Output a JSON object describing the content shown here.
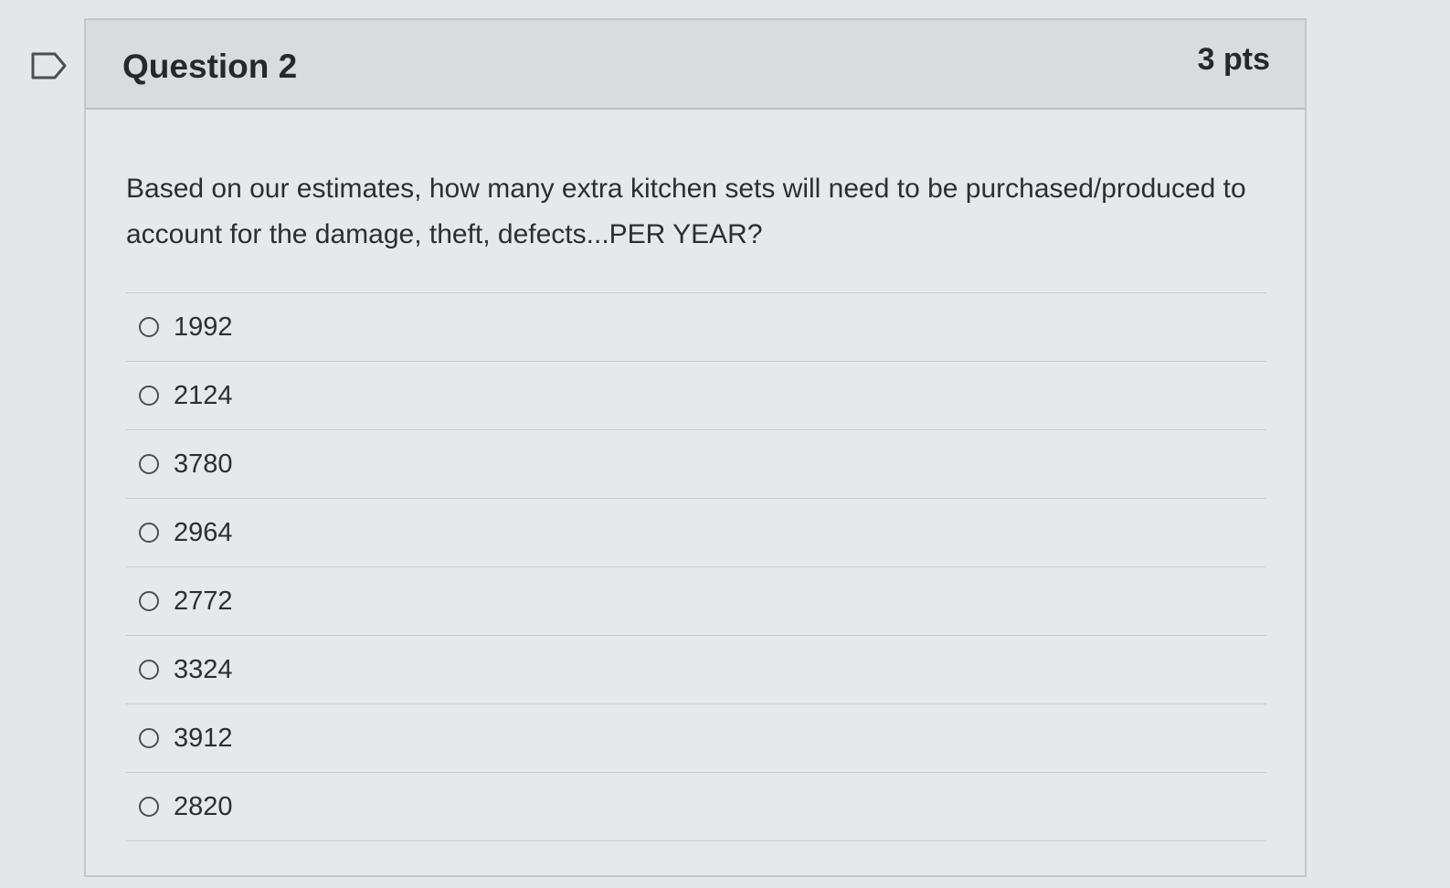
{
  "question": {
    "title": "Question 2",
    "points": "3 pts",
    "text": "Based on our estimates, how many extra kitchen sets will need to be purchased/produced to account for the damage, theft, defects...PER YEAR?",
    "answers": [
      {
        "label": "1992"
      },
      {
        "label": "2124"
      },
      {
        "label": "3780"
      },
      {
        "label": "2964"
      },
      {
        "label": "2772"
      },
      {
        "label": "3324"
      },
      {
        "label": "3912"
      },
      {
        "label": "2820"
      }
    ]
  },
  "icons": {
    "flag": "flag-question-icon"
  }
}
